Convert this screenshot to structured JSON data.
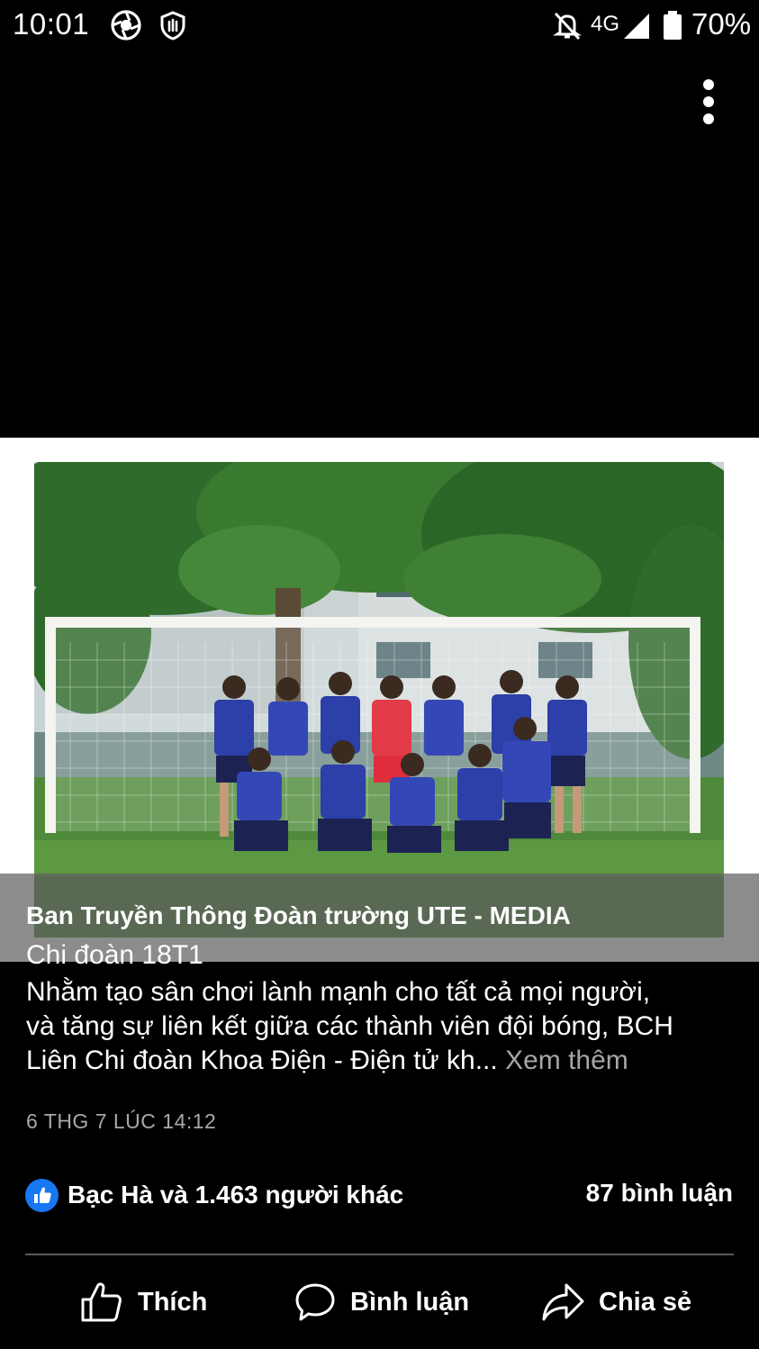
{
  "status_bar": {
    "time": "10:01",
    "left_icons": [
      "aperture-icon",
      "shield-hand-icon"
    ],
    "network": "4G",
    "battery": "70%",
    "right_icons": [
      "bell-off-icon",
      "signal-icon",
      "battery-icon"
    ]
  },
  "post": {
    "author": "Ban Truyền Thông Đoàn trường UTE - MEDIA",
    "group": "Chi đoàn 18T1",
    "text_lines": [
      "Nhằm tạo sân chơi lành mạnh cho tất cả mọi người,",
      "và tăng sự liên kết giữa các thành viên đội bóng, BCH",
      "Liên Chi đoàn Khoa Điện - Điện tử kh..."
    ],
    "see_more": "Xem thêm",
    "timestamp": "6 THG 7 LÚC 14:12"
  },
  "reactions": {
    "summary": "Bạc Hà và 1.463 người khác",
    "comments": "87 bình luận"
  },
  "actions": {
    "like": "Thích",
    "comment": "Bình luận",
    "share": "Chia sẻ"
  },
  "colors": {
    "background": "#000000",
    "like_blue": "#1877f2",
    "muted_text": "#a8a8a8"
  }
}
